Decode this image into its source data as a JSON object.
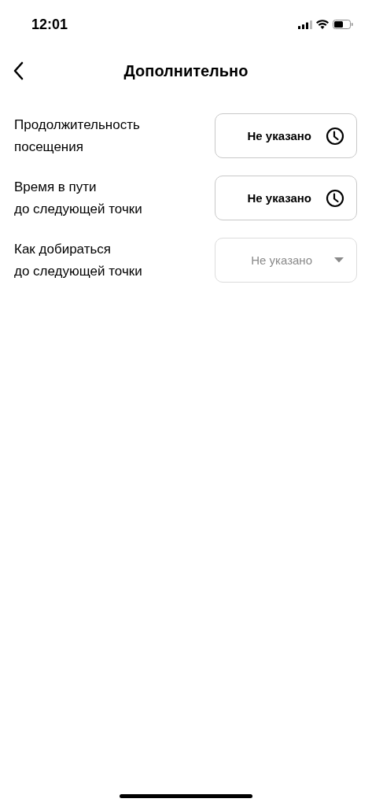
{
  "status_bar": {
    "time": "12:01"
  },
  "header": {
    "title": "Дополнительно"
  },
  "fields": [
    {
      "label": "Продолжительность\nпосещения",
      "value": "Не указано",
      "kind": "time"
    },
    {
      "label": "Время в пути\nдо следующей точки",
      "value": "Не указано",
      "kind": "time"
    },
    {
      "label": "Как добираться\nдо следующей точки",
      "placeholder": "Не указано",
      "kind": "select"
    }
  ]
}
